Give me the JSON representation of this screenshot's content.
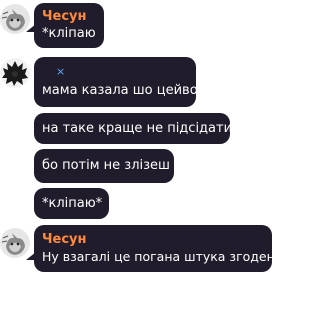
{
  "messages": [
    {
      "sender": "Чесун",
      "text": "*кліпаю"
    },
    {
      "text": "мама казала шо цейво"
    },
    {
      "text": "на таке краще не підсідати"
    },
    {
      "text": "бо потім не злізеш"
    },
    {
      "text": "*кліпаю*"
    },
    {
      "sender": "Чесун",
      "text": "Ну взагалі це погана штука згоден"
    }
  ],
  "icons": {
    "avatar_1": "cat-avatar",
    "avatar_2": "dark-fluffy-avatar",
    "avatar_3": "cat-avatar",
    "inline_mark": "close-icon"
  },
  "inline_mark_glyph": "×",
  "colors": {
    "bubble": "#211c2b",
    "sender_name": "#ff8a3d",
    "text": "#ffffff",
    "inline_mark": "#5aa8ff"
  }
}
